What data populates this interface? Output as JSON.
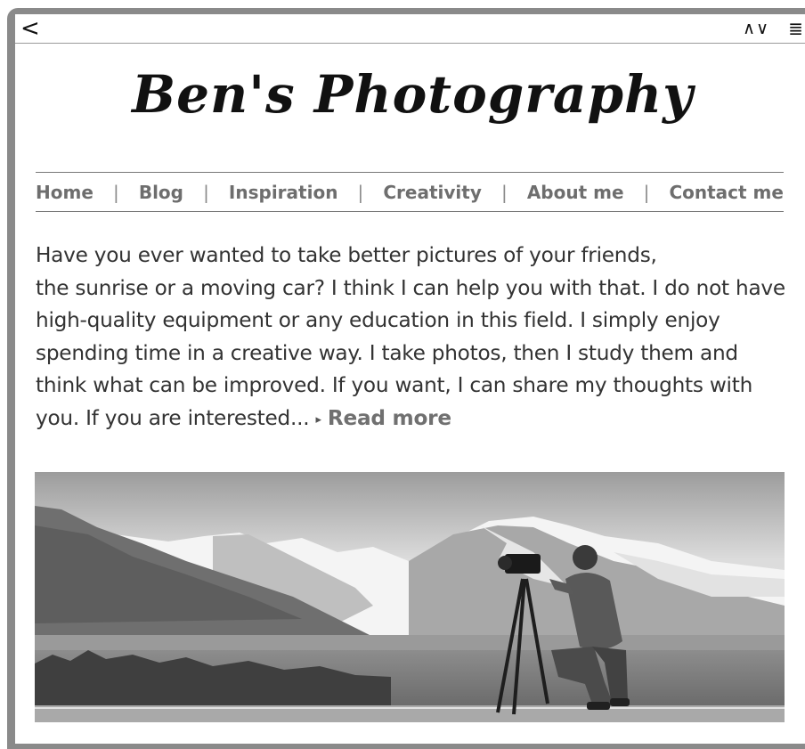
{
  "topbar": {
    "back_icon": "<",
    "updown_icon": "∧∨",
    "menu_icon": "≣"
  },
  "site": {
    "title": "Ben's Photography"
  },
  "nav": {
    "items": [
      {
        "label": "Home"
      },
      {
        "label": "Blog"
      },
      {
        "label": "Inspiration"
      },
      {
        "label": "Creativity"
      },
      {
        "label": "About  me"
      },
      {
        "label": "Contact  me"
      }
    ],
    "separator": "|"
  },
  "intro": {
    "line1": "Have you ever wanted to take better pictures of your friends,",
    "body": "the sunrise or a moving car? I think I can help you with that. I do not have high-quality equipment or any education in this field. I simply enjoy spending time in a creative way. I take photos, then I study them and think what can be improved. If you want, I can share my thoughts with you. If you are interested...",
    "read_more_arrow": "▸",
    "read_more": "Read more"
  },
  "hero_image": {
    "icon": "photographer-mountains-image"
  }
}
